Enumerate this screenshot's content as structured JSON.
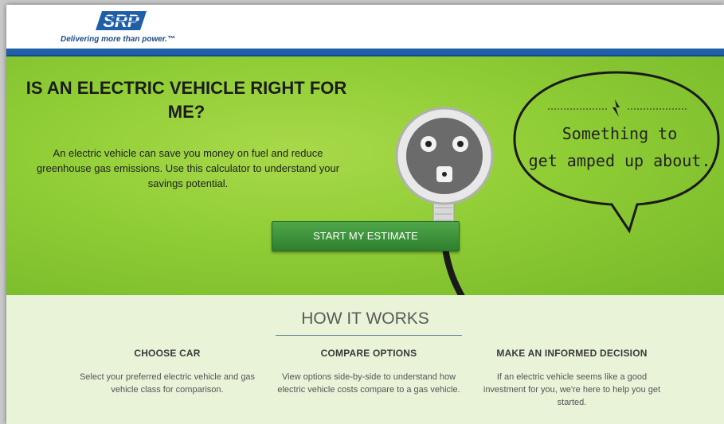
{
  "header": {
    "logo_text": "SRP",
    "tagline": "Delivering more than power.™"
  },
  "hero": {
    "title_line1": "IS AN ELECTRIC VEHICLE RIGHT FOR",
    "title_line2": "ME?",
    "description": "An electric vehicle can save you money on fuel and reduce greenhouse gas emissions. Use this calculator to understand your savings potential.",
    "cta_label": "START MY ESTIMATE",
    "bubble_line1": "Something to",
    "bubble_line2": "get amped up about."
  },
  "how_it_works": {
    "title": "HOW IT WORKS",
    "steps": [
      {
        "heading": "CHOOSE CAR",
        "body": "Select your preferred electric vehicle and gas vehicle class for comparison."
      },
      {
        "heading": "COMPARE OPTIONS",
        "body": "View options side-by-side to understand how electric vehicle costs compare to a gas vehicle."
      },
      {
        "heading": "MAKE AN INFORMED DECISION",
        "body": "If an electric vehicle seems like a good investment for you, we're here to help you get started."
      }
    ]
  },
  "colors": {
    "brand_blue": "#1f5fa8",
    "hero_green": "#8fcd35",
    "button_green": "#3d9440"
  }
}
